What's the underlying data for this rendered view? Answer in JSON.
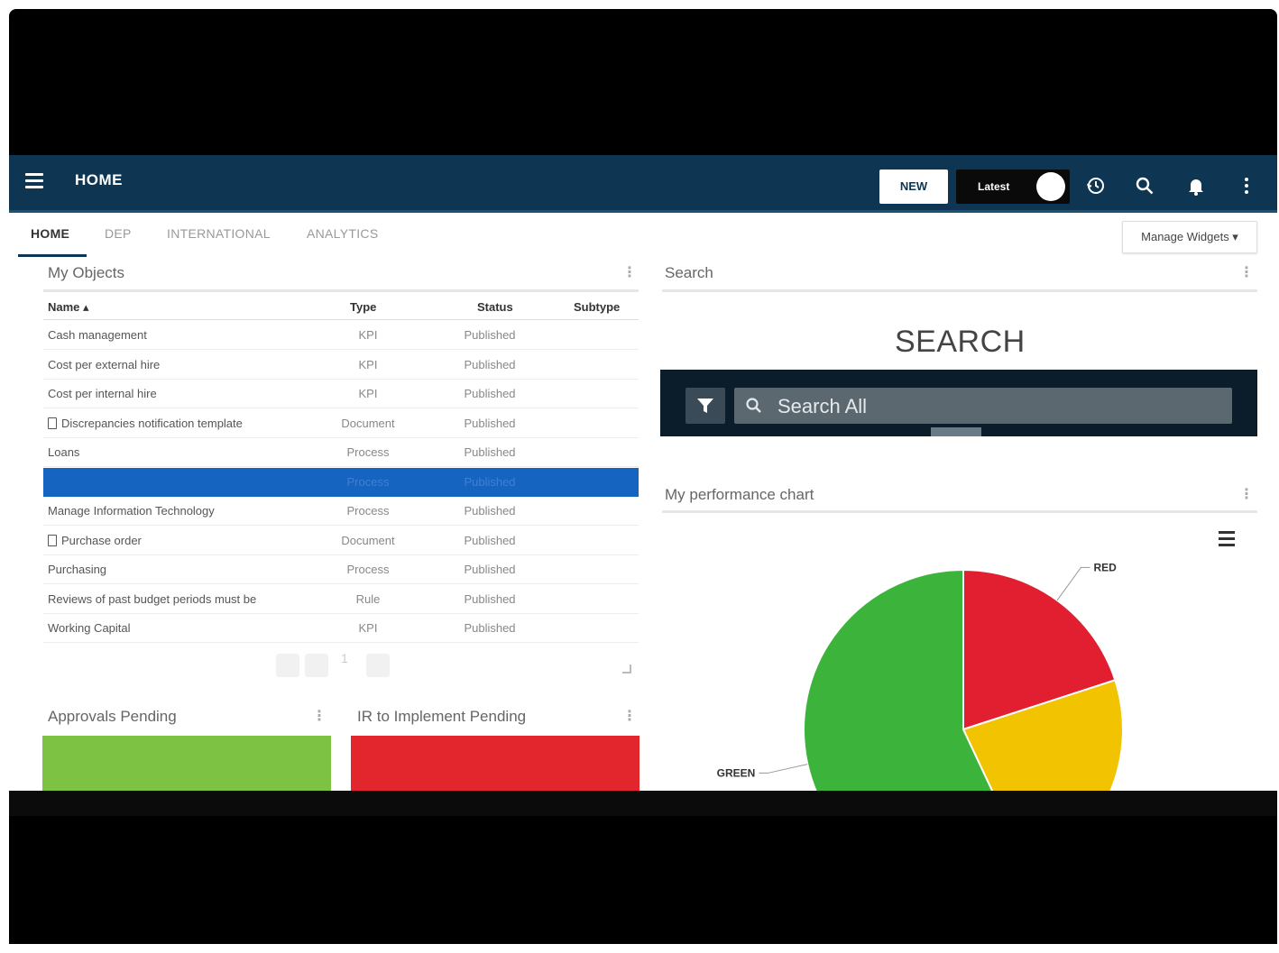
{
  "navbar": {
    "title": "HOME",
    "new_label": "NEW",
    "latest_label": "Latest"
  },
  "tabs": [
    {
      "label": "HOME",
      "active": true
    },
    {
      "label": "DEP"
    },
    {
      "label": "INTERNATIONAL"
    },
    {
      "label": "ANALYTICS"
    }
  ],
  "manage_widgets_label": "Manage Widgets ▾",
  "my_objects": {
    "title": "My Objects",
    "columns": [
      "Name ▴",
      "Type",
      "Status",
      "Subtype"
    ],
    "rows": [
      {
        "name": "Cash management",
        "type": "KPI",
        "status": "Published"
      },
      {
        "name": "Cost per external hire",
        "type": "KPI",
        "status": "Published"
      },
      {
        "name": "Cost per internal hire",
        "type": "KPI",
        "status": "Published"
      },
      {
        "name": "Discrepancies notification template",
        "type": "Document",
        "status": "Published",
        "icon": "document-icon"
      },
      {
        "name": "Loans",
        "type": "Process",
        "status": "Published"
      },
      {
        "name": "",
        "type": "Process",
        "status": "Published",
        "selected": true
      },
      {
        "name": "Manage Information Technology",
        "type": "Process",
        "status": "Published"
      },
      {
        "name": "Purchase order",
        "type": "Document",
        "status": "Published",
        "icon": "document-icon"
      },
      {
        "name": "Purchasing",
        "type": "Process",
        "status": "Published"
      },
      {
        "name": "Reviews of past budget periods must be",
        "type": "Rule",
        "status": "Published"
      },
      {
        "name": "Working Capital",
        "type": "KPI",
        "status": "Published"
      }
    ],
    "page": "1"
  },
  "approvals": {
    "title": "Approvals Pending",
    "color": "#7dc243"
  },
  "implement": {
    "title": "IR to Implement Pending",
    "color": "#e3262d"
  },
  "search": {
    "widget_title": "Search",
    "heading": "SEARCH",
    "placeholder": "Search All"
  },
  "performance": {
    "title": "My performance chart"
  },
  "chart_data": {
    "type": "pie",
    "categories": [
      "RED",
      "YELLOW",
      "GREEN"
    ],
    "labels_shown": [
      "RED",
      "GREEN"
    ],
    "values": [
      20,
      23,
      57
    ],
    "colors": [
      "#e21f30",
      "#f2c300",
      "#3cb43c"
    ]
  }
}
